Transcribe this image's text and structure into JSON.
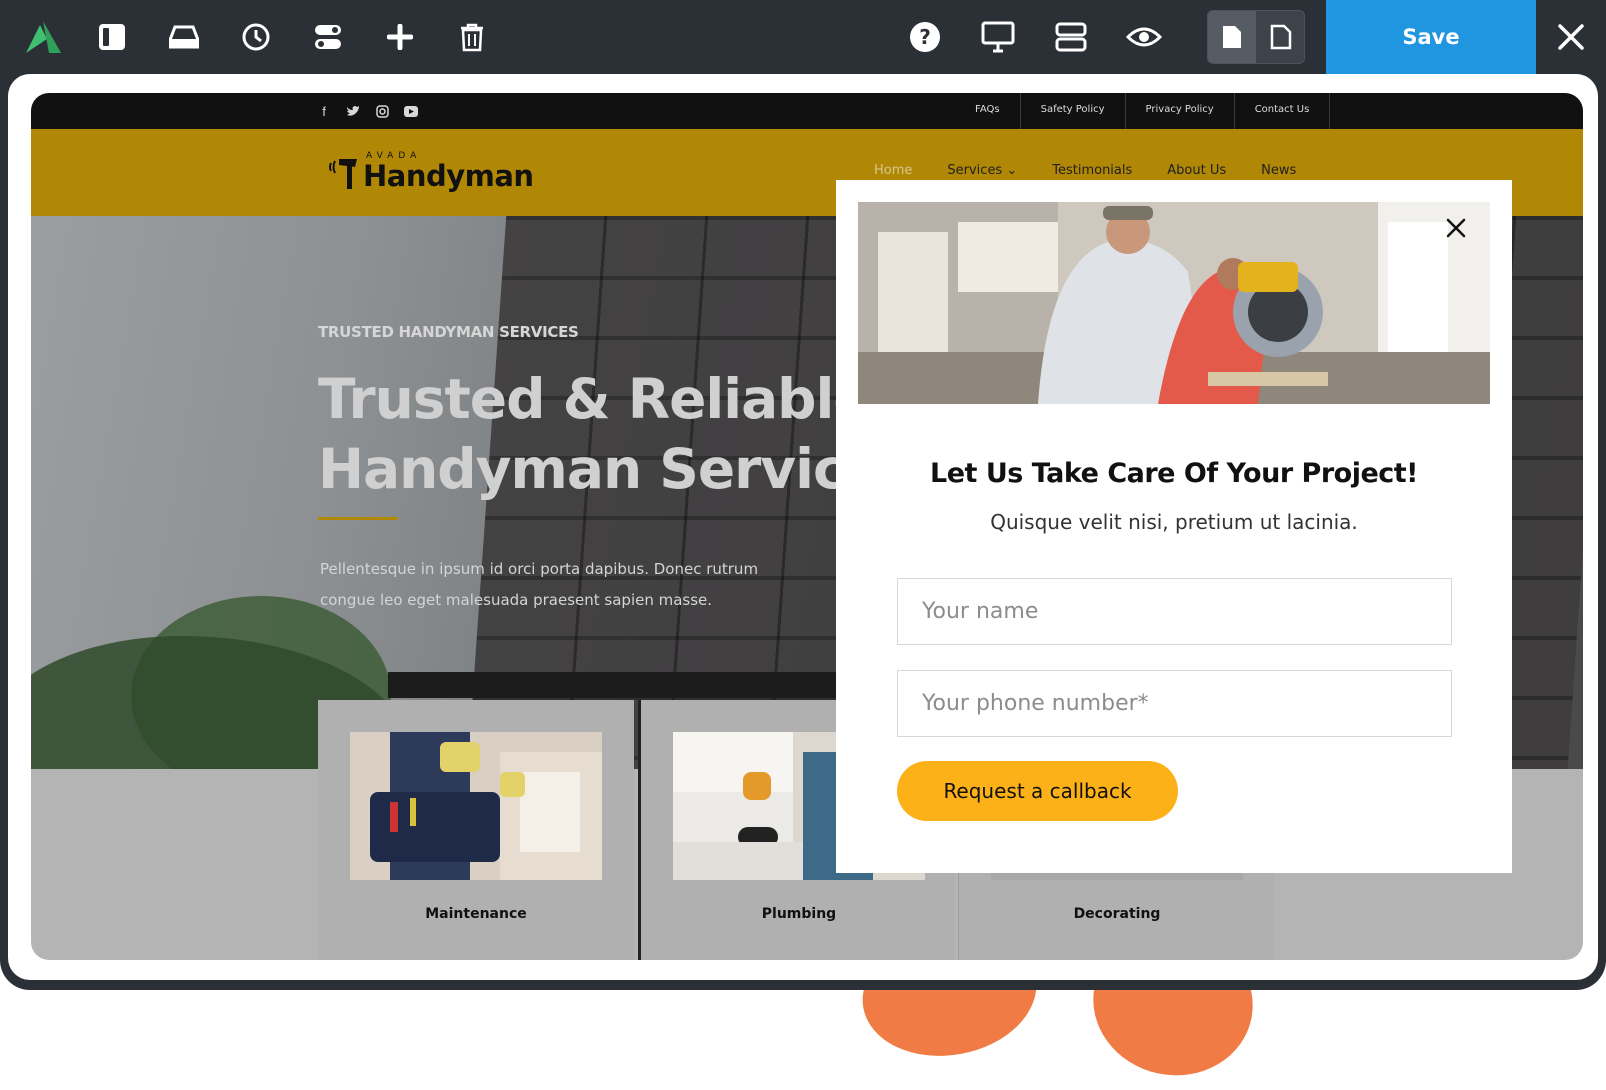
{
  "toolbar": {
    "save_label": "Save",
    "icons": [
      "avada-logo-icon",
      "sidebar-icon",
      "drive-icon",
      "history-icon",
      "toggles-icon",
      "add-icon",
      "trash-icon",
      "help-icon",
      "desktop-icon",
      "layout-icon",
      "preview-eye-icon",
      "page-filled-icon",
      "page-outline-icon",
      "close-icon"
    ]
  },
  "site": {
    "top_links": [
      "FAQs",
      "Safety Policy",
      "Privacy Policy",
      "Contact Us"
    ],
    "brand_small": "AVADA",
    "brand": "Handyman",
    "nav": [
      {
        "label": "Home",
        "active": true
      },
      {
        "label": "Services ⌄",
        "active": false
      },
      {
        "label": "Testimonials",
        "active": false
      },
      {
        "label": "About Us",
        "active": false
      },
      {
        "label": "News",
        "active": false
      }
    ],
    "hero": {
      "eyebrow": "TRUSTED HANDYMAN SERVICES",
      "title_line1": "Trusted & Reliable",
      "title_line2": "Handyman Service",
      "body": "Pellentesque in ipsum id orci porta dapibus. Donec rutrum congue leo eget malesuada praesent sapien masse."
    },
    "cards": [
      "Maintenance",
      "Plumbing",
      "Decorating"
    ]
  },
  "modal": {
    "title": "Let Us Take Care Of Your Project!",
    "subtitle": "Quisque velit nisi, pretium ut lacinia.",
    "name_placeholder": "Your name",
    "phone_placeholder": "Your phone number*",
    "cta": "Request a callback"
  },
  "colors": {
    "toolbar_bg": "#2b3036",
    "save_blue": "#2196e0",
    "header_gold": "#b18806",
    "cta_yellow": "#fbb117",
    "blob_orange": "#f07b45"
  }
}
